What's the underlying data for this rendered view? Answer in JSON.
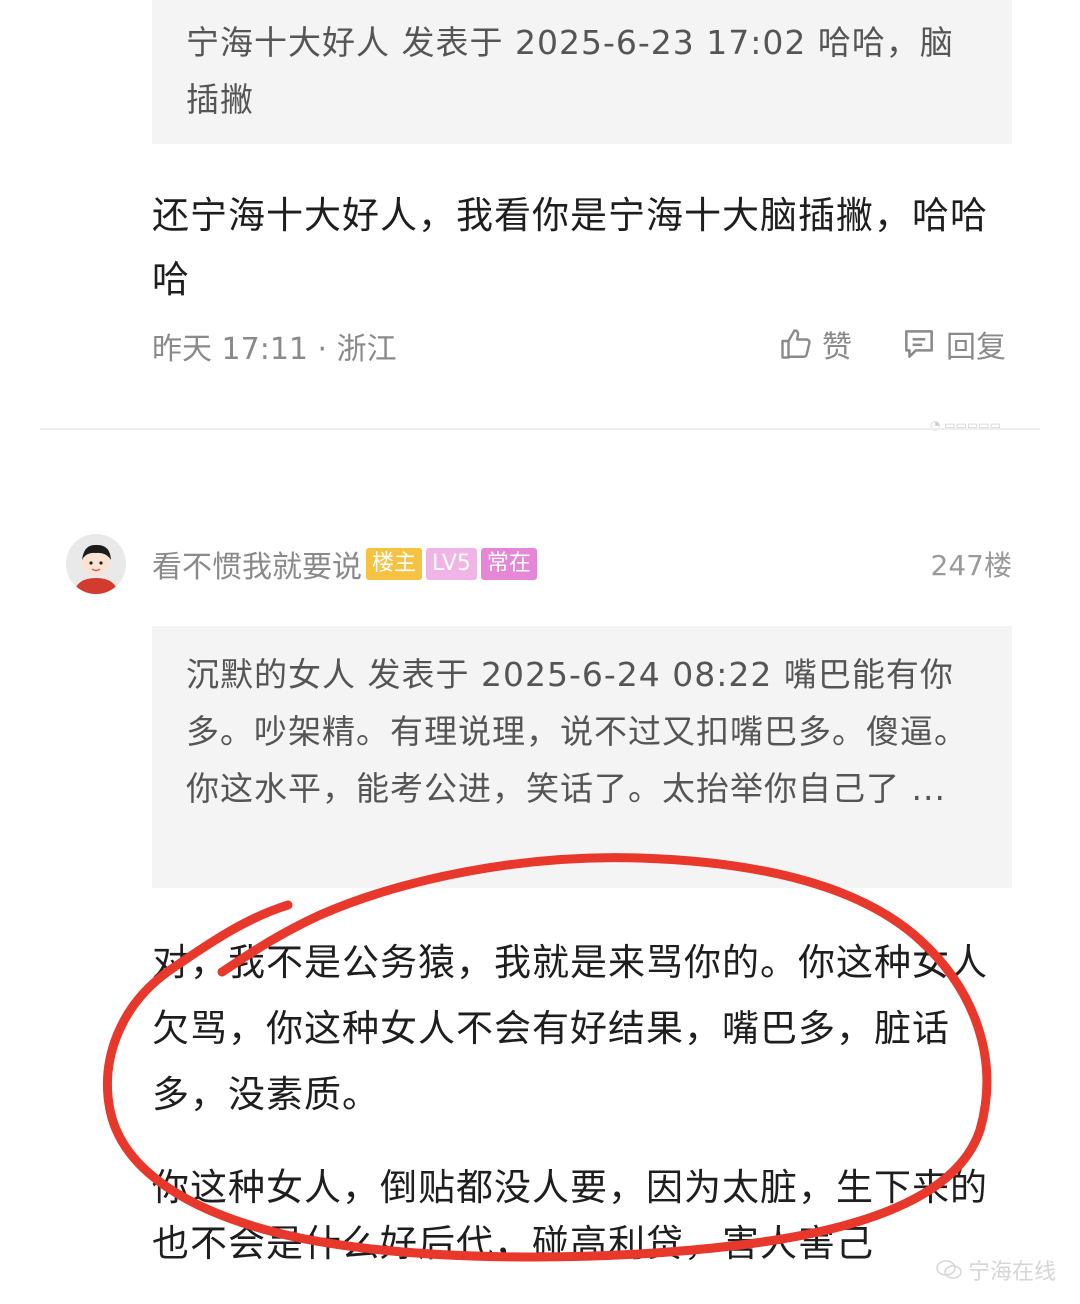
{
  "quote1": {
    "text": "宁海十大好人 发表于 2025-6-23 17:02 哈哈，脑插撇"
  },
  "reply1": {
    "text": "还宁海十大好人，我看你是宁海十大脑插撇，哈哈哈"
  },
  "reply1_meta": {
    "time_location": "昨天 17:11 · 浙江",
    "like_label": "赞",
    "reply_label": "回复"
  },
  "post2": {
    "username": "看不惯我就要说",
    "badges": [
      "楼主",
      "LV5",
      "常在"
    ],
    "floor": "247楼"
  },
  "quote2": {
    "text": "沉默的女人 发表于 2025-6-24 08:22 嘴巴能有你多。吵架精。有理说理，说不过又扣嘴巴多。傻逼。你这水平，能考公进，笑话了。太抬举你自己了 ..."
  },
  "reply2": {
    "p1": "对，我不是公务猿，我就是来骂你的。你这种女人欠骂，你这种女人不会有好结果，嘴巴多，脏话多，没素质。",
    "p2": "你这种女人，倒贴都没人要，因为太脏，生下来的也不会是什么好后代，碰高利贷，害人害己"
  },
  "watermark": {
    "text": "宁海在线",
    "sub": "www.nhzj.com"
  },
  "icons": {
    "thumb": "thumbs-up-icon",
    "comment": "comment-icon",
    "watermark": "wechat-icon"
  }
}
